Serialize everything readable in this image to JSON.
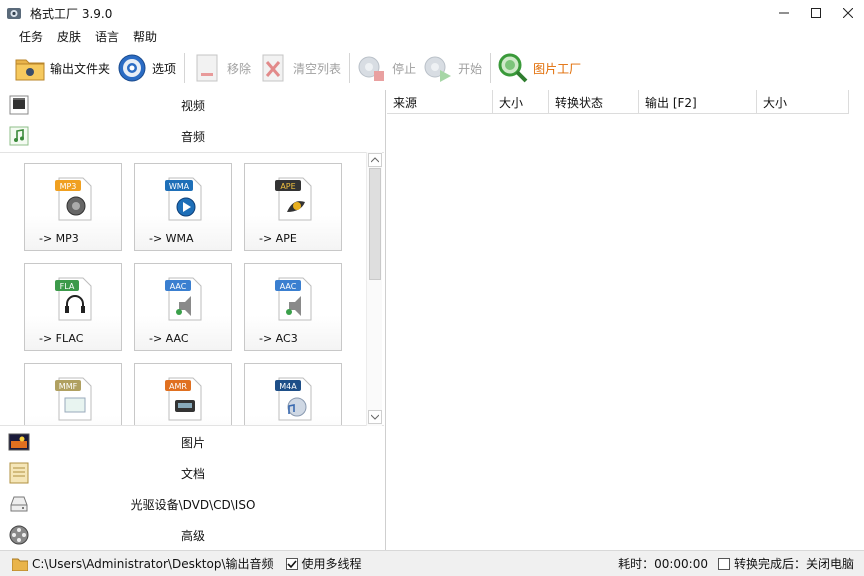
{
  "window": {
    "title": "格式工厂 3.9.0"
  },
  "menu": [
    "任务",
    "皮肤",
    "语言",
    "帮助"
  ],
  "toolbar": {
    "output_folder": "输出文件夹",
    "options": "选项",
    "remove": "移除",
    "clear_list": "清空列表",
    "stop": "停止",
    "start": "开始",
    "picture_factory": "图片工厂"
  },
  "categories": {
    "video": "视频",
    "audio": "音频",
    "picture": "图片",
    "document": "文档",
    "disc": "光驱设备\\DVD\\CD\\ISO",
    "advanced": "高级"
  },
  "tiles": [
    {
      "badge": "MP3",
      "label": "-> MP3",
      "color": "#f0a020"
    },
    {
      "badge": "WMA",
      "label": "-> WMA",
      "color": "#1e6fb8"
    },
    {
      "badge": "APE",
      "label": "-> APE",
      "color": "#333333"
    },
    {
      "badge": "FLA",
      "label": "-> FLAC",
      "color": "#3c9a4a"
    },
    {
      "badge": "AAC",
      "label": "-> AAC",
      "color": "#3a7fd0"
    },
    {
      "badge": "AAC",
      "label": "-> AC3",
      "color": "#3a7fd0"
    },
    {
      "badge": "MMF",
      "label": "",
      "color": "#b0a060"
    },
    {
      "badge": "AMR",
      "label": "",
      "color": "#e07020"
    },
    {
      "badge": "M4A",
      "label": "",
      "color": "#1e4f88"
    }
  ],
  "table": {
    "columns": [
      "来源",
      "大小",
      "转换状态",
      "输出 [F2]",
      "大小"
    ]
  },
  "status": {
    "path": "C:\\Users\\Administrator\\Desktop\\输出音频",
    "multithread": "使用多线程",
    "elapsed": "耗时：00:00:00",
    "after_convert": "转换完成后：关闭电脑"
  }
}
